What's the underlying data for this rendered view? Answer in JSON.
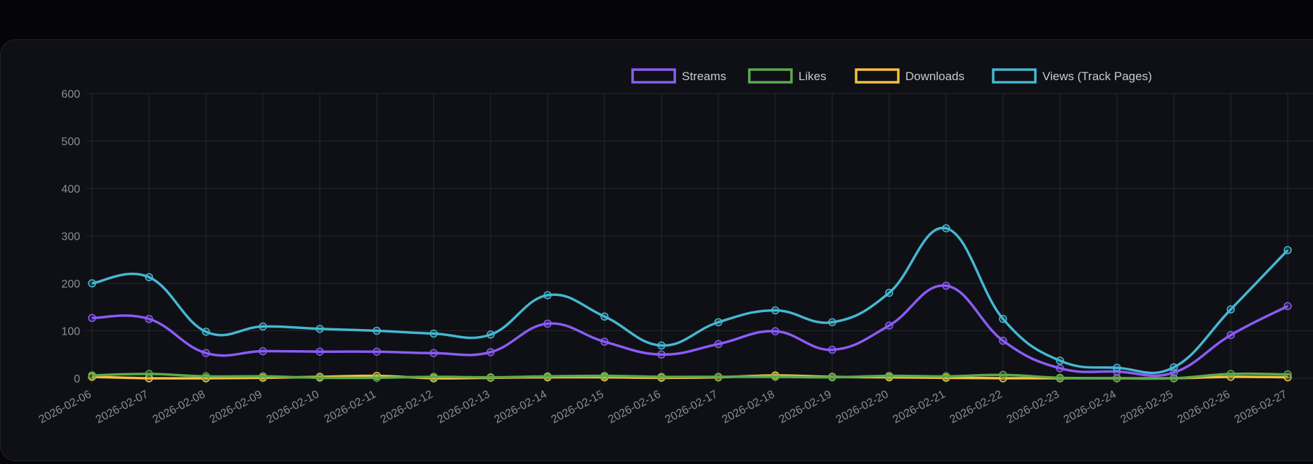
{
  "chart_data": {
    "type": "line",
    "title": "",
    "xlabel": "",
    "ylabel": "",
    "ylim": [
      0,
      600
    ],
    "yticks": [
      "0",
      "100",
      "200",
      "300",
      "400",
      "500",
      "600"
    ],
    "grid": true,
    "legend_position": "top",
    "categories": [
      "2026-02-06",
      "2026-02-07",
      "2026-02-08",
      "2026-02-09",
      "2026-02-10",
      "2026-02-11",
      "2026-02-12",
      "2026-02-13",
      "2026-02-14",
      "2026-02-15",
      "2026-02-16",
      "2026-02-17",
      "2026-02-18",
      "2026-02-19",
      "2026-02-20",
      "2026-02-21",
      "2026-02-22",
      "2026-02-23",
      "2026-02-24",
      "2026-02-25",
      "2026-02-26",
      "2026-02-27"
    ],
    "series": [
      {
        "name": "Streams",
        "color": "#8b5cf6",
        "values": [
          127,
          125,
          53,
          57,
          56,
          56,
          53,
          55,
          115,
          77,
          50,
          72,
          99,
          60,
          111,
          195,
          79,
          21,
          14,
          12,
          91,
          152
        ]
      },
      {
        "name": "Likes",
        "color": "#5cab4f",
        "values": [
          6,
          9,
          4,
          4,
          1,
          1,
          3,
          2,
          4,
          5,
          3,
          3,
          3,
          2,
          5,
          4,
          7,
          1,
          0,
          0,
          9,
          8
        ]
      },
      {
        "name": "Downloads",
        "color": "#f5c13b",
        "values": [
          3,
          0,
          0,
          1,
          3,
          5,
          0,
          1,
          2,
          2,
          1,
          2,
          6,
          3,
          2,
          1,
          0,
          0,
          0,
          0,
          3,
          2
        ]
      },
      {
        "name": "Views (Track Pages)",
        "color": "#45b8d2",
        "values": [
          200,
          213,
          98,
          109,
          104,
          100,
          94,
          92,
          175,
          130,
          69,
          118,
          143,
          118,
          180,
          316,
          125,
          37,
          22,
          23,
          145,
          270
        ]
      }
    ]
  }
}
